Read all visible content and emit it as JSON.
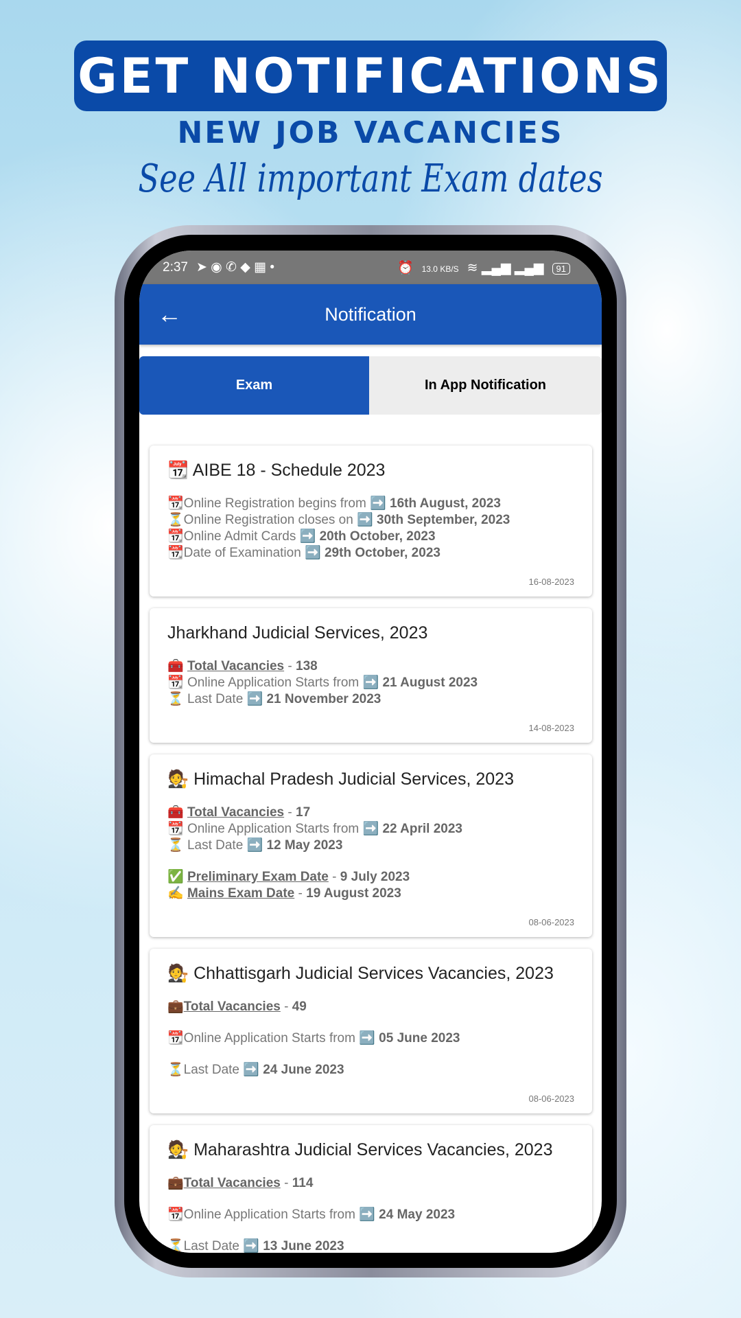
{
  "promo": {
    "headline": "GET NOTIFICATIONS",
    "subheadline": "NEW JOB VACANCIES",
    "tagline": "See All important Exam dates"
  },
  "status_bar": {
    "time": "2:37",
    "left_icons": [
      "telegram-icon",
      "messenger-icon",
      "whatsapp-icon",
      "education-icon",
      "app-icon",
      "dot-icon"
    ],
    "net_speed": "13.0 KB/S",
    "battery": "91"
  },
  "app_bar": {
    "title": "Notification",
    "back_icon": "arrow-left-icon"
  },
  "tabs": [
    {
      "label": "Exam",
      "active": true
    },
    {
      "label": "In App Notification",
      "active": false
    }
  ],
  "colors": {
    "primary": "#1a57b8",
    "banner": "#0a4aa8"
  },
  "cards": [
    {
      "title": "📆 AIBE 18 - Schedule 2023",
      "date": "16-08-2023",
      "groups": [
        [
          {
            "icon": "📆",
            "text": "Online Registration begins from ➡️ ",
            "value": "16th August, 2023"
          },
          {
            "icon": "⏳",
            "text": "Online Registration closes on ➡️ ",
            "value": "30th September, 2023"
          },
          {
            "icon": "📆",
            "text": "Online Admit Cards ➡️ ",
            "value": "20th October, 2023"
          },
          {
            "icon": "📆",
            "text": "Date of Examination ➡️ ",
            "value": "29th October, 2023"
          }
        ]
      ]
    },
    {
      "title": "Jharkhand Judicial Services, 2023",
      "date": "14-08-2023",
      "groups": [
        [
          {
            "icon": "🧰 ",
            "label": "Total Vacancies",
            "text": " - ",
            "value": "138"
          },
          {
            "icon": "📆 ",
            "text": "Online Application Starts from ➡️ ",
            "value": "21 August 2023"
          },
          {
            "icon": "⏳ ",
            "text": "Last Date ➡️ ",
            "value": "21 November 2023"
          }
        ]
      ]
    },
    {
      "title": "🧑‍⚖️ Himachal Pradesh Judicial Services, 2023",
      "date": "08-06-2023",
      "groups": [
        [],
        [
          {
            "icon": "🧰 ",
            "label": "Total Vacancies",
            "text": " - ",
            "value": "17"
          },
          {
            "icon": "📆 ",
            "text": "Online Application Starts from ➡️ ",
            "value": "22 April 2023"
          },
          {
            "icon": "⏳ ",
            "text": "Last Date ➡️ ",
            "value": "12 May 2023"
          }
        ],
        [
          {
            "icon": "✅ ",
            "label": "Preliminary Exam Date",
            "text": " - ",
            "value": "9 July 2023"
          },
          {
            "icon": "✍️ ",
            "label": "Mains Exam Date",
            "text": " - ",
            "value": "19 August 2023"
          }
        ]
      ]
    },
    {
      "title": "🧑‍⚖️ Chhattisgarh Judicial Services Vacancies, 2023",
      "date": "08-06-2023",
      "groups": [
        [
          {
            "icon": "💼",
            "label": "Total Vacancies",
            "text": " - ",
            "value": "49"
          }
        ],
        [
          {
            "icon": "📆",
            "text": "Online Application Starts from ➡️ ",
            "value": "05 June 2023"
          }
        ],
        [
          {
            "icon": "⏳",
            "text": "Last Date ➡️ ",
            "value": "24 June 2023"
          }
        ]
      ]
    },
    {
      "title": "🧑‍⚖️ Maharashtra Judicial Services Vacancies, 2023",
      "date": "",
      "groups": [
        [
          {
            "icon": "💼",
            "label": "Total Vacancies",
            "text": " - ",
            "value": "114"
          }
        ],
        [
          {
            "icon": "📆",
            "text": "Online Application Starts from ➡️ ",
            "value": "24 May 2023"
          }
        ],
        [
          {
            "icon": "⏳",
            "text": "Last Date ➡️ ",
            "value": "13 June 2023"
          }
        ]
      ]
    }
  ]
}
